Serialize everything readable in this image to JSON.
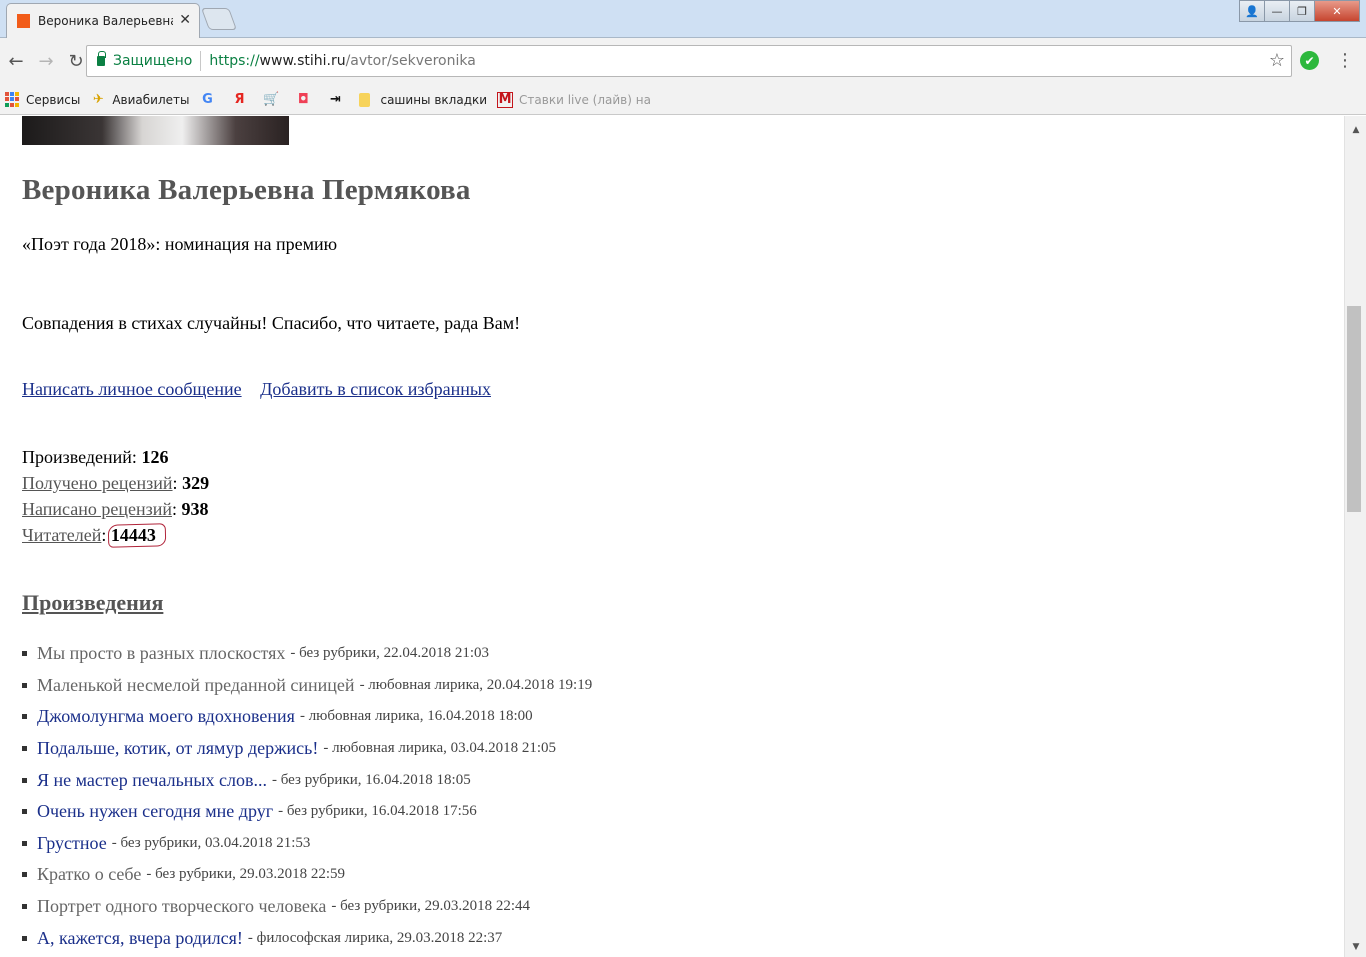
{
  "browser": {
    "tab_title": "Вероника Валерьевна П",
    "tab_close": "✕",
    "window_buttons": {
      "user": "👤",
      "minimize": "—",
      "restore": "❐",
      "close": "✕"
    },
    "nav": {
      "back": "←",
      "forward": "→",
      "reload": "↻"
    },
    "secure_label": "Защищено",
    "url_scheme": "https://",
    "url_host": "www.stihi.ru",
    "url_path": "/avtor/sekveronika",
    "star": "☆",
    "extension_mark": "✔",
    "menu": "⋮",
    "bookmarks": [
      {
        "label": "Сервисы",
        "icon": "apps-grid-icon"
      },
      {
        "label": "Авиабилеты",
        "icon": "airplane-icon",
        "glyph": "✈"
      },
      {
        "label": "",
        "icon": "google-icon",
        "glyph": "G"
      },
      {
        "label": "",
        "icon": "yandex-icon",
        "glyph": "Я"
      },
      {
        "label": "",
        "icon": "cart-icon",
        "glyph": "🛒"
      },
      {
        "label": "",
        "icon": "pocket-icon",
        "glyph": "◘"
      },
      {
        "label": "",
        "icon": "exit-icon",
        "glyph": "⇥"
      },
      {
        "label": "сашины вкладки",
        "icon": "folder-icon"
      },
      {
        "label": "Ставки live (лайв) на",
        "icon": "m-icon",
        "glyph": "M"
      }
    ]
  },
  "profile": {
    "name": "Вероника Валерьевна Пермякова",
    "award": "«Поэт года 2018»: номинация на премию",
    "motto": "Совпадения в стихах случайны! Спасибо, что читаете, рада Вам!",
    "link_message": "Написать личное сообщение",
    "link_favorites": "Добавить в список избранных"
  },
  "stats": {
    "works_label": "Произведений:",
    "works_value": "126",
    "received_label": "Получено рецензий",
    "received_value": "329",
    "written_label": "Написано рецензий",
    "written_value": "938",
    "readers_label": "Читателей",
    "readers_value": "14443",
    "colon": ":"
  },
  "section_title": "Произведения",
  "works": [
    {
      "title": "Мы просто в разных плоскостях",
      "meta": "- без рубрики, 22.04.2018 21:03",
      "visited": true
    },
    {
      "title": "Маленькой несмелой преданной синицей",
      "meta": "- любовная лирика, 20.04.2018 19:19",
      "visited": true
    },
    {
      "title": "Джомолунгма моего вдохновения",
      "meta": "- любовная лирика, 16.04.2018 18:00",
      "visited": false
    },
    {
      "title": "Подальше, котик, от лямур держись!",
      "meta": "- любовная лирика, 03.04.2018 21:05",
      "visited": false
    },
    {
      "title": "Я не мастер печальных слов...",
      "meta": "- без рубрики, 16.04.2018 18:05",
      "visited": false
    },
    {
      "title": "Очень нужен сегодня мне друг",
      "meta": "- без рубрики, 16.04.2018 17:56",
      "visited": false
    },
    {
      "title": "Грустное",
      "meta": "- без рубрики, 03.04.2018 21:53",
      "visited": false
    },
    {
      "title": "Кратко о себе",
      "meta": "- без рубрики, 29.03.2018 22:59",
      "visited": true
    },
    {
      "title": "Портрет одного творческого человека",
      "meta": "- без рубрики, 29.03.2018 22:44",
      "visited": true
    },
    {
      "title": "А, кажется, вчера родился!",
      "meta": "- философская лирика, 29.03.2018 22:37",
      "visited": false
    }
  ],
  "colors": {
    "link": "#1a2f8a",
    "visited": "#666666",
    "secure": "#0b8043",
    "annotation": "#b0243a"
  }
}
